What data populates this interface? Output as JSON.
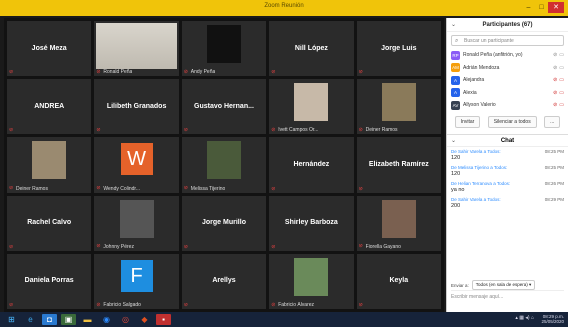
{
  "window": {
    "title": "Zoom Reunión"
  },
  "tiles": [
    {
      "name": "José Meza",
      "label": "",
      "kind": "name"
    },
    {
      "name": "",
      "label": "Ronald Peña",
      "kind": "whiteboard"
    },
    {
      "name": "",
      "label": "Andy Peña",
      "kind": "photo",
      "color": "#111"
    },
    {
      "name": "Nill López",
      "label": "",
      "kind": "name"
    },
    {
      "name": "Jorge Luis",
      "label": "",
      "kind": "name"
    },
    {
      "name": "ANDREA",
      "label": "",
      "kind": "name"
    },
    {
      "name": "Lilibeth Granados",
      "label": "",
      "kind": "name"
    },
    {
      "name": "Gustavo Hernan...",
      "label": "",
      "kind": "name"
    },
    {
      "name": "",
      "label": "Ivett Campos Or...",
      "kind": "photo",
      "color": "#c7b9a8"
    },
    {
      "name": "",
      "label": "Deiner Ramos",
      "kind": "photo",
      "color": "#8a7a5a"
    },
    {
      "name": "",
      "label": "Deiner Ramos",
      "kind": "photo",
      "color": "#9a8a70"
    },
    {
      "name": "",
      "label": "Wendy Colindr...",
      "kind": "avatar",
      "letter": "W",
      "color": "#e5622a"
    },
    {
      "name": "",
      "label": "Melissa Tijerino",
      "kind": "photo",
      "color": "#4a5a3a"
    },
    {
      "name": "Hernández",
      "label": "",
      "kind": "name"
    },
    {
      "name": "Elizabeth Ramírez",
      "label": "",
      "kind": "name"
    },
    {
      "name": "Rachel Calvo",
      "label": "",
      "kind": "name"
    },
    {
      "name": "",
      "label": "Johnny Pérez",
      "kind": "photo",
      "color": "#555"
    },
    {
      "name": "Jorge Murillo",
      "label": "",
      "kind": "name"
    },
    {
      "name": "Shirley Barboza",
      "label": "",
      "kind": "name"
    },
    {
      "name": "",
      "label": "Fiorella Gayano",
      "kind": "photo",
      "color": "#7a6050"
    },
    {
      "name": "Daniela Porras",
      "label": "",
      "kind": "name"
    },
    {
      "name": "",
      "label": "Fabricio Salgado",
      "kind": "avatar",
      "letter": "F",
      "color": "#1e8ee0"
    },
    {
      "name": "Arellys",
      "label": "",
      "kind": "name"
    },
    {
      "name": "",
      "label": "Fabricio Álvarez",
      "kind": "photo",
      "color": "#6a8a5a"
    },
    {
      "name": "Keyla",
      "label": "",
      "kind": "name"
    }
  ],
  "participants": {
    "header": "Participantes (67)",
    "search_placeholder": "Buscar un participante",
    "list": [
      {
        "initials": "RP",
        "name": "Ronald Peña (anfitrión, yo)",
        "color": "#8b5cf6",
        "icon": "grey"
      },
      {
        "initials": "AM",
        "name": "Adrián Mendoza",
        "color": "#f59e0b",
        "icon": "grey"
      },
      {
        "initials": "A",
        "name": "Alejandra",
        "color": "#2563eb",
        "icon": "red"
      },
      {
        "initials": "A",
        "name": "Alexia",
        "color": "#2563eb",
        "icon": "red"
      },
      {
        "initials": "AV",
        "name": "Allyson Valerio",
        "color": "#374151",
        "icon": "red"
      }
    ],
    "invite_label": "Invitar",
    "mute_all_label": "Silenciar a todos",
    "more_label": "..."
  },
  "chat": {
    "header": "Chat",
    "messages": [
      {
        "from": "De Sahir Varela a Todos:",
        "time": "08:25 PM",
        "body": "120"
      },
      {
        "from": "De Melissa Tijerino a Todos:",
        "time": "08:25 PM",
        "body": "120"
      },
      {
        "from": "De Helian Terranova a Todos:",
        "time": "08:26 PM",
        "body": "ya no"
      },
      {
        "from": "De Sahir Varela a Todos:",
        "time": "08:29 PM",
        "body": "200"
      }
    ],
    "send_to_label": "Enviar a:",
    "send_to_value": "Todos (en sala de espera) ▾",
    "input_placeholder": "Escribir mensaje aquí..."
  },
  "taskbar": {
    "time": "08:29 p.m.",
    "date": "25/05/2020"
  },
  "colors": {
    "titlebar": "#f0c40a",
    "taskbar": "#16233a",
    "accent": "#2d8cff"
  }
}
